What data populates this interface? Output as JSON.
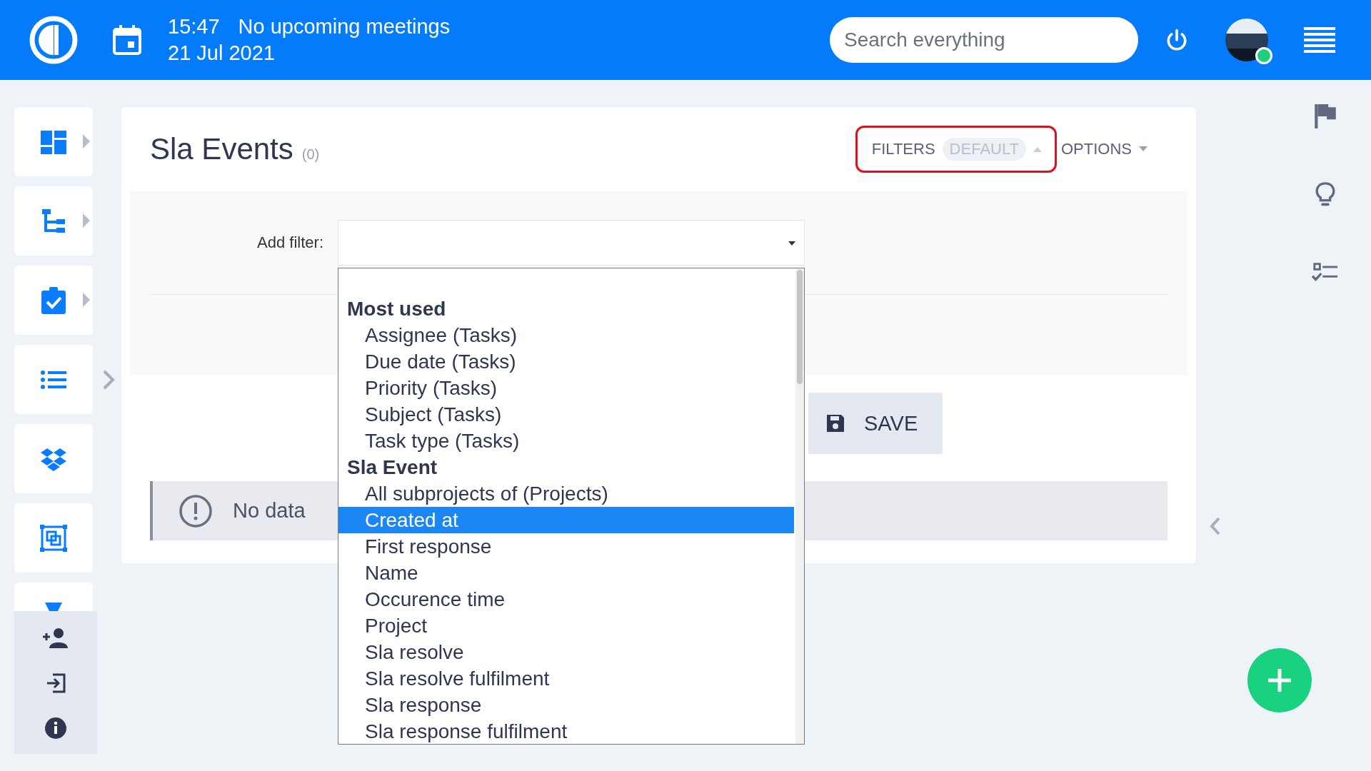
{
  "topbar": {
    "time": "15:47",
    "meetings": "No upcoming meetings",
    "date": "21 Jul 2021",
    "search": {
      "placeholder": "Search everything"
    },
    "user": {
      "online": true
    }
  },
  "sidebar": {
    "items": [
      {
        "has_submenu": true
      },
      {
        "has_submenu": true
      },
      {
        "has_submenu": true
      },
      {
        "has_submenu": false
      },
      {
        "has_submenu": false
      },
      {
        "has_submenu": false
      }
    ]
  },
  "page": {
    "title": "Sla Events",
    "count": "(0)",
    "filters_button": "FILTERS",
    "filters_badge": "DEFAULT",
    "filters_expanded": true,
    "options_button": "OPTIONS"
  },
  "filter_panel": {
    "add_filter_label": "Add filter:"
  },
  "dropdown": {
    "groups": [
      {
        "label": "Most used",
        "options": [
          {
            "label": "Assignee (Tasks)",
            "selected": false
          },
          {
            "label": "Due date (Tasks)",
            "selected": false
          },
          {
            "label": "Priority (Tasks)",
            "selected": false
          },
          {
            "label": "Subject (Tasks)",
            "selected": false
          },
          {
            "label": "Task type (Tasks)",
            "selected": false
          }
        ]
      },
      {
        "label": "Sla Event",
        "options": [
          {
            "label": "All subprojects of (Projects)",
            "selected": false
          },
          {
            "label": "Created at",
            "selected": true
          },
          {
            "label": "First response",
            "selected": false
          },
          {
            "label": "Name",
            "selected": false
          },
          {
            "label": "Occurence time",
            "selected": false
          },
          {
            "label": "Project",
            "selected": false
          },
          {
            "label": "Sla resolve",
            "selected": false
          },
          {
            "label": "Sla resolve fulfilment",
            "selected": false
          },
          {
            "label": "Sla response",
            "selected": false
          },
          {
            "label": "Sla response fulfilment",
            "selected": false
          }
        ]
      }
    ]
  },
  "save_button": "SAVE",
  "empty_message": "No data"
}
